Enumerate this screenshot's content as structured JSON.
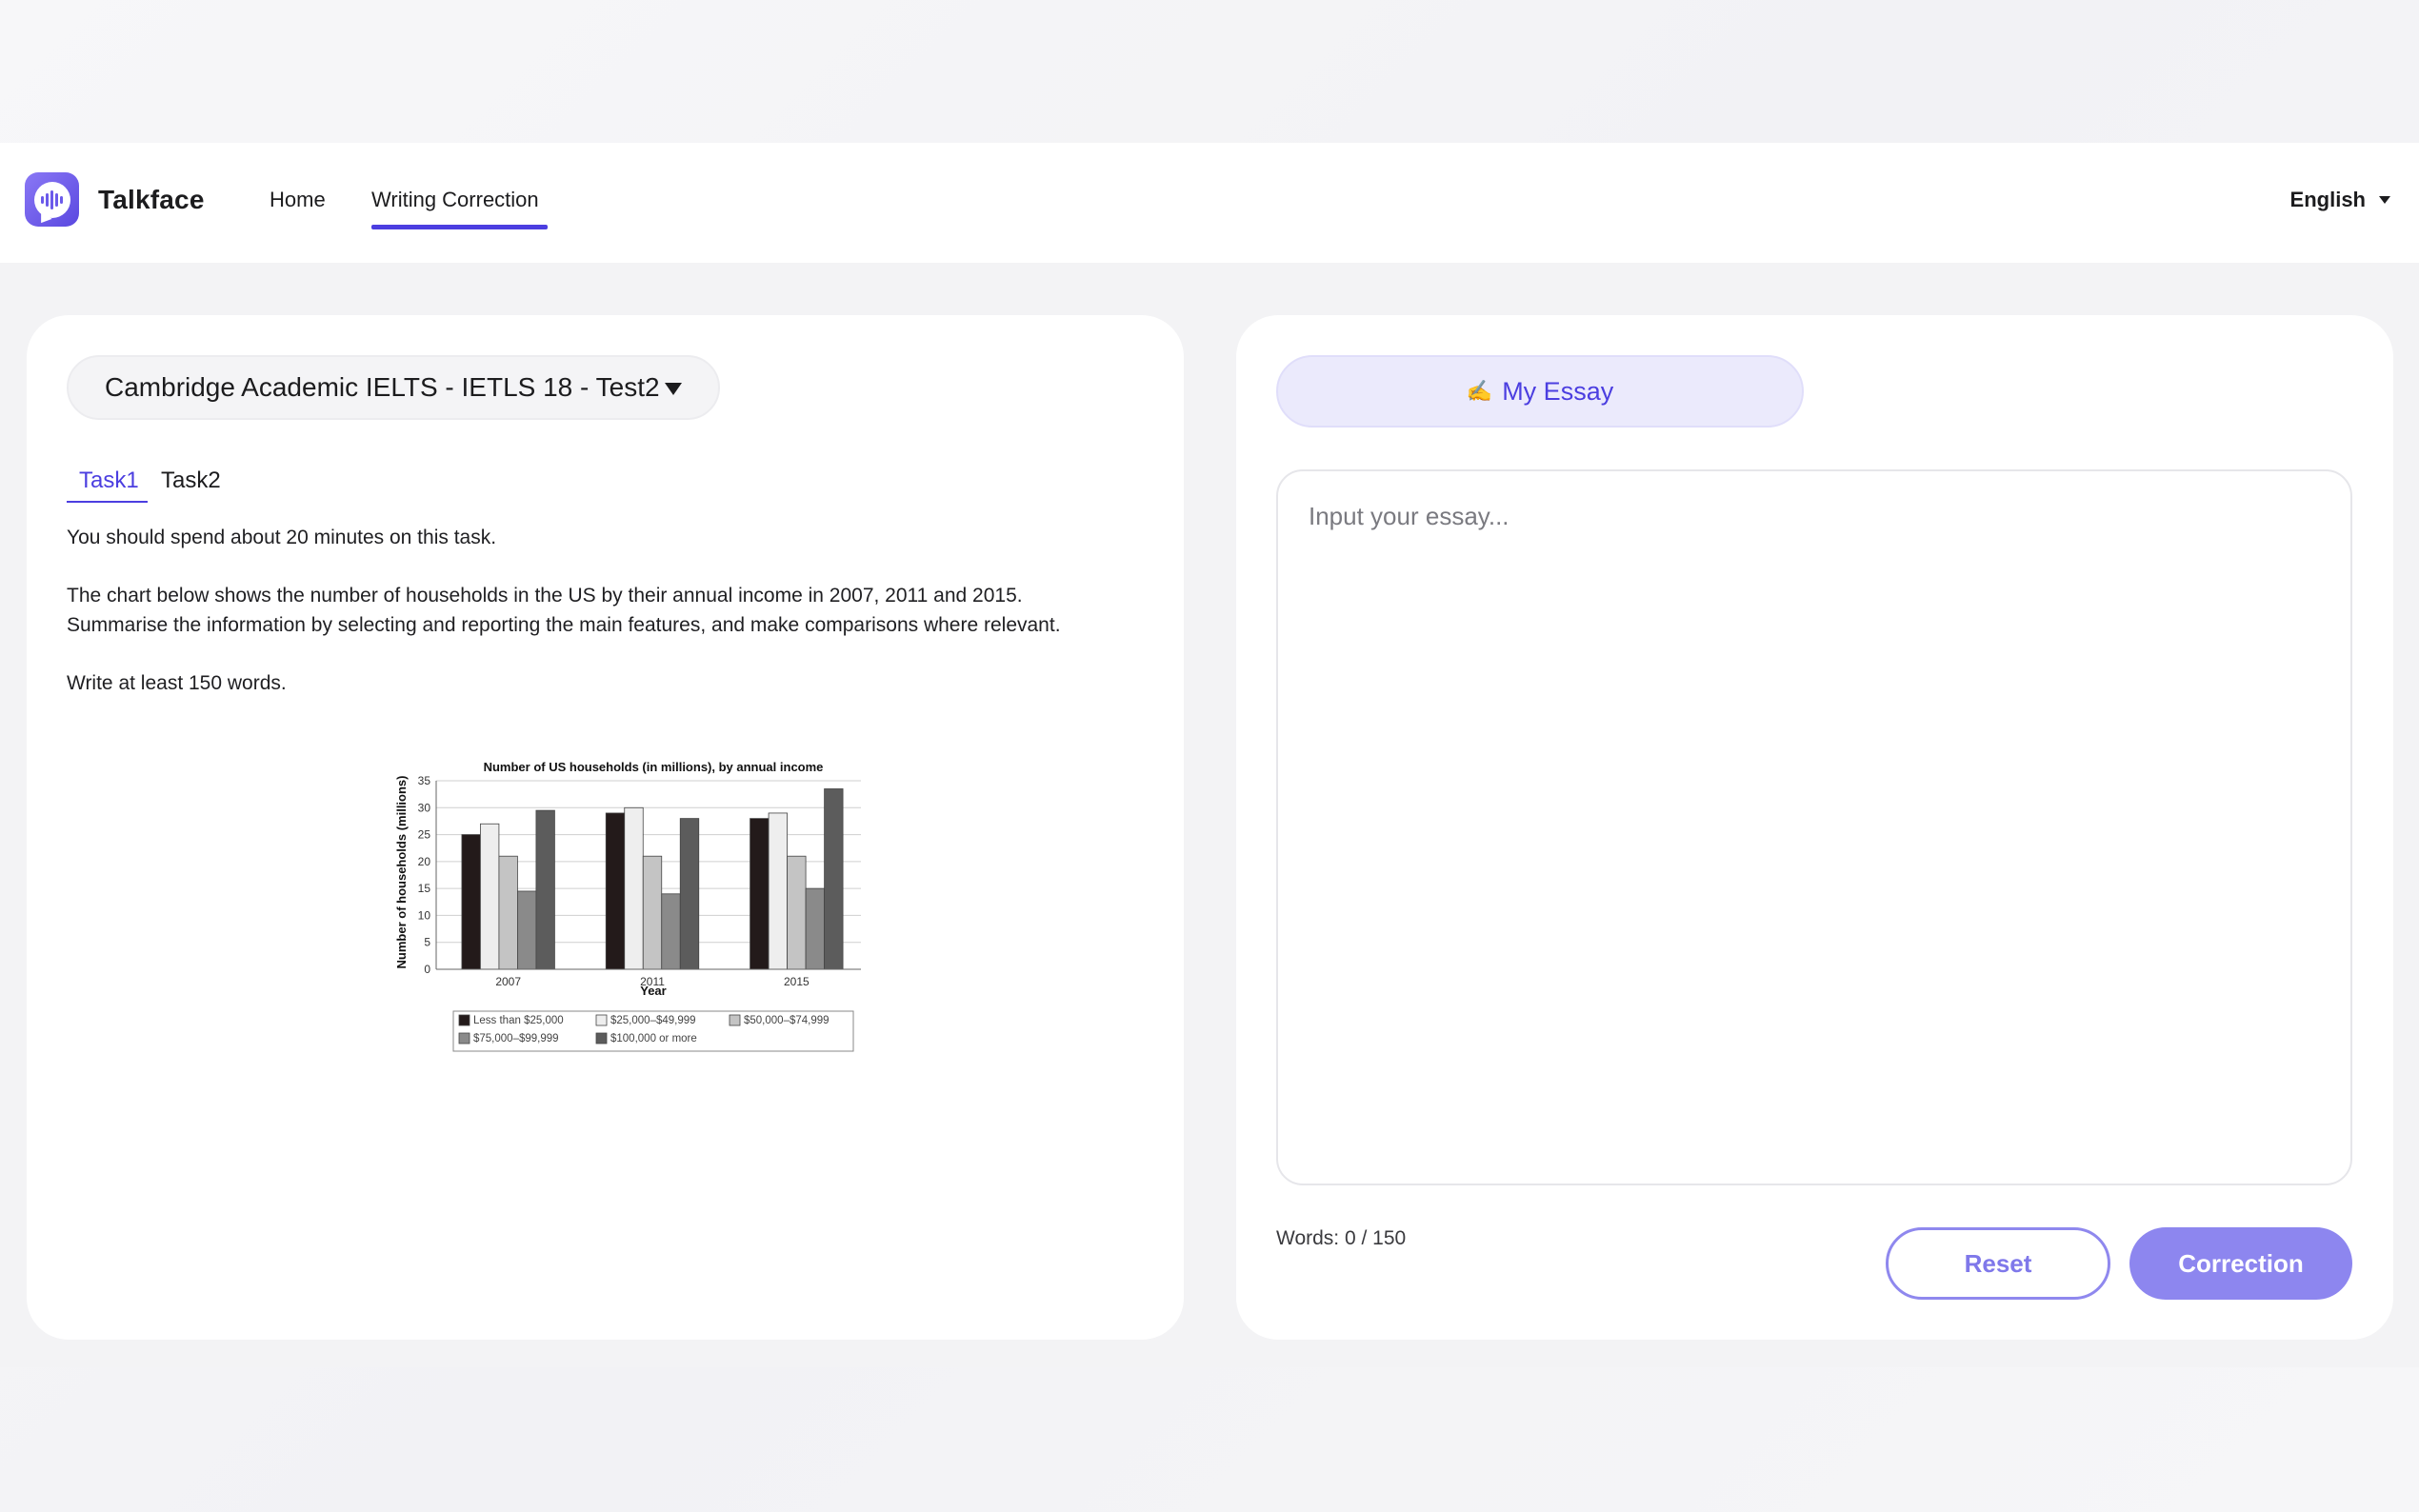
{
  "header": {
    "brand": "Talkface",
    "nav": {
      "home": "Home",
      "writing": "Writing Correction"
    },
    "language": "English"
  },
  "left_panel": {
    "book_select": "Cambridge Academic IELTS - IETLS 18 - Test2",
    "tabs": {
      "task1": "Task1",
      "task2": "Task2"
    },
    "prompt": {
      "line1": "You should spend about 20 minutes on this task.",
      "line2": "The chart below shows the number of households in the US by their annual income in 2007, 2011 and 2015.",
      "line3": "Summarise the information by selecting and reporting the main features, and make comparisons where relevant.",
      "line4": "Write at least 150 words."
    }
  },
  "chart_data": {
    "type": "bar",
    "title": "Number of US households (in millions), by annual income",
    "xlabel": "Year",
    "ylabel": "Number of households (millions)",
    "ylim": [
      0,
      35
    ],
    "yticks": [
      0,
      5,
      10,
      15,
      20,
      25,
      30,
      35
    ],
    "categories": [
      "2007",
      "2011",
      "2015"
    ],
    "series": [
      {
        "name": "Less than $25,000",
        "values": [
          25,
          29,
          28
        ],
        "color": "#231a1a"
      },
      {
        "name": "$25,000–$49,999",
        "values": [
          27,
          30,
          29
        ],
        "color": "#eeeeee"
      },
      {
        "name": "$50,000–$74,999",
        "values": [
          21,
          21,
          21
        ],
        "color": "#c4c4c4"
      },
      {
        "name": "$75,000–$99,999",
        "values": [
          14.5,
          14,
          15
        ],
        "color": "#8a8a8a"
      },
      {
        "name": "$100,000 or more",
        "values": [
          29.5,
          28,
          33.5
        ],
        "color": "#5c5c5c"
      }
    ],
    "grid": true,
    "legend_position": "bottom"
  },
  "right_panel": {
    "tab_label": "My Essay",
    "essay_placeholder": "Input your essay...",
    "word_count": "Words: 0 / 150",
    "reset_label": "Reset",
    "correction_label": "Correction"
  },
  "colors": {
    "accent": "#4b3ee0",
    "button_fill": "#8d86ef",
    "pill_bg": "#ebeafc"
  }
}
